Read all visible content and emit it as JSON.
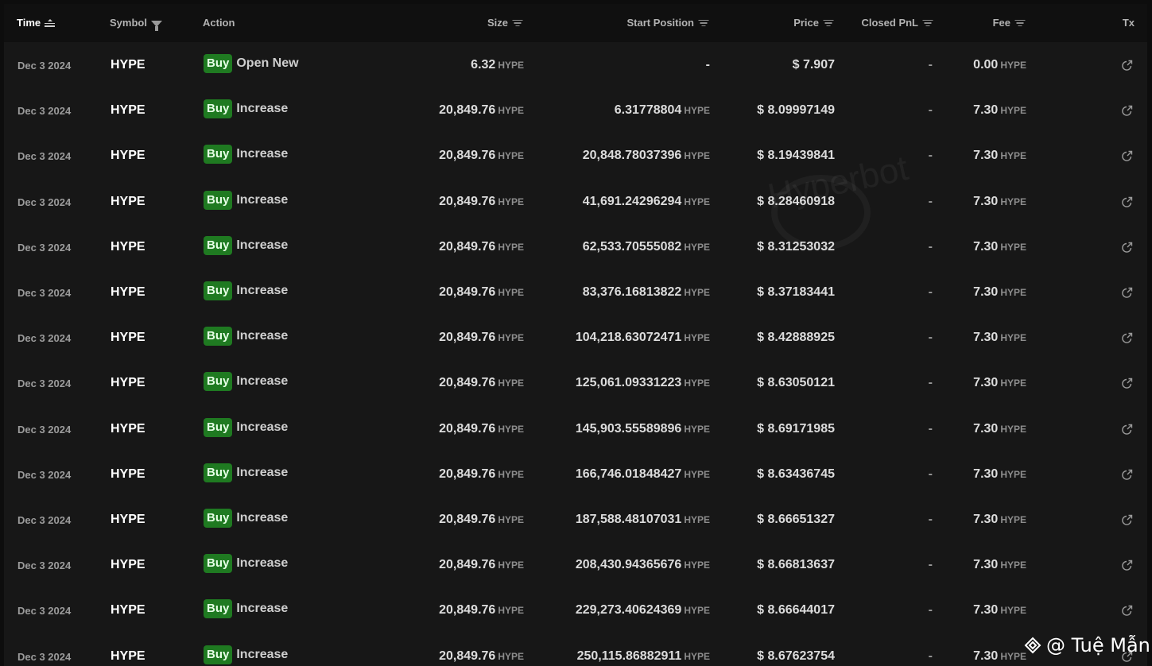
{
  "table": {
    "columns": [
      {
        "label": "Time",
        "icon": "sort-ascending-icon"
      },
      {
        "label": "Symbol",
        "icon": "funnel-icon"
      },
      {
        "label": "Action",
        "icon": ""
      },
      {
        "label": "Size",
        "icon": "filter-lines-icon"
      },
      {
        "label": "Start Position",
        "icon": "filter-lines-icon"
      },
      {
        "label": "Price",
        "icon": "filter-lines-icon"
      },
      {
        "label": "Closed PnL",
        "icon": "filter-lines-icon"
      },
      {
        "label": "Fee",
        "icon": "filter-lines-icon"
      },
      {
        "label": "Tx",
        "icon": ""
      }
    ],
    "unit": "HYPE",
    "buy_color": "#1f7a21",
    "rows": [
      {
        "time": "Dec 3 2024",
        "symbol": "HYPE",
        "side": "Buy",
        "action": "Open New",
        "size": "6.32",
        "start_position": "-",
        "price": "$ 7.907",
        "closed_pnl": "-",
        "fee": "0.00"
      },
      {
        "time": "Dec 3 2024",
        "symbol": "HYPE",
        "side": "Buy",
        "action": "Increase",
        "size": "20,849.76",
        "start_position": "6.31778804",
        "price": "$ 8.09997149",
        "closed_pnl": "-",
        "fee": "7.30"
      },
      {
        "time": "Dec 3 2024",
        "symbol": "HYPE",
        "side": "Buy",
        "action": "Increase",
        "size": "20,849.76",
        "start_position": "20,848.78037396",
        "price": "$ 8.19439841",
        "closed_pnl": "-",
        "fee": "7.30"
      },
      {
        "time": "Dec 3 2024",
        "symbol": "HYPE",
        "side": "Buy",
        "action": "Increase",
        "size": "20,849.76",
        "start_position": "41,691.24296294",
        "price": "$ 8.28460918",
        "closed_pnl": "-",
        "fee": "7.30"
      },
      {
        "time": "Dec 3 2024",
        "symbol": "HYPE",
        "side": "Buy",
        "action": "Increase",
        "size": "20,849.76",
        "start_position": "62,533.70555082",
        "price": "$ 8.31253032",
        "closed_pnl": "-",
        "fee": "7.30"
      },
      {
        "time": "Dec 3 2024",
        "symbol": "HYPE",
        "side": "Buy",
        "action": "Increase",
        "size": "20,849.76",
        "start_position": "83,376.16813822",
        "price": "$ 8.37183441",
        "closed_pnl": "-",
        "fee": "7.30"
      },
      {
        "time": "Dec 3 2024",
        "symbol": "HYPE",
        "side": "Buy",
        "action": "Increase",
        "size": "20,849.76",
        "start_position": "104,218.63072471",
        "price": "$ 8.42888925",
        "closed_pnl": "-",
        "fee": "7.30"
      },
      {
        "time": "Dec 3 2024",
        "symbol": "HYPE",
        "side": "Buy",
        "action": "Increase",
        "size": "20,849.76",
        "start_position": "125,061.09331223",
        "price": "$ 8.63050121",
        "closed_pnl": "-",
        "fee": "7.30"
      },
      {
        "time": "Dec 3 2024",
        "symbol": "HYPE",
        "side": "Buy",
        "action": "Increase",
        "size": "20,849.76",
        "start_position": "145,903.55589896",
        "price": "$ 8.69171985",
        "closed_pnl": "-",
        "fee": "7.30"
      },
      {
        "time": "Dec 3 2024",
        "symbol": "HYPE",
        "side": "Buy",
        "action": "Increase",
        "size": "20,849.76",
        "start_position": "166,746.01848427",
        "price": "$ 8.63436745",
        "closed_pnl": "-",
        "fee": "7.30"
      },
      {
        "time": "Dec 3 2024",
        "symbol": "HYPE",
        "side": "Buy",
        "action": "Increase",
        "size": "20,849.76",
        "start_position": "187,588.48107031",
        "price": "$ 8.66651327",
        "closed_pnl": "-",
        "fee": "7.30"
      },
      {
        "time": "Dec 3 2024",
        "symbol": "HYPE",
        "side": "Buy",
        "action": "Increase",
        "size": "20,849.76",
        "start_position": "208,430.94365676",
        "price": "$ 8.66813637",
        "closed_pnl": "-",
        "fee": "7.30"
      },
      {
        "time": "Dec 3 2024",
        "symbol": "HYPE",
        "side": "Buy",
        "action": "Increase",
        "size": "20,849.76",
        "start_position": "229,273.40624369",
        "price": "$ 8.66644017",
        "closed_pnl": "-",
        "fee": "7.30"
      },
      {
        "time": "Dec 3 2024",
        "symbol": "HYPE",
        "side": "Buy",
        "action": "Increase",
        "size": "20,849.76",
        "start_position": "250,115.86882911",
        "price": "$ 8.67623754",
        "closed_pnl": "-",
        "fee": "7.30"
      }
    ]
  },
  "watermark": "Hyperbot",
  "credit": "@ Tuệ Mẫn"
}
